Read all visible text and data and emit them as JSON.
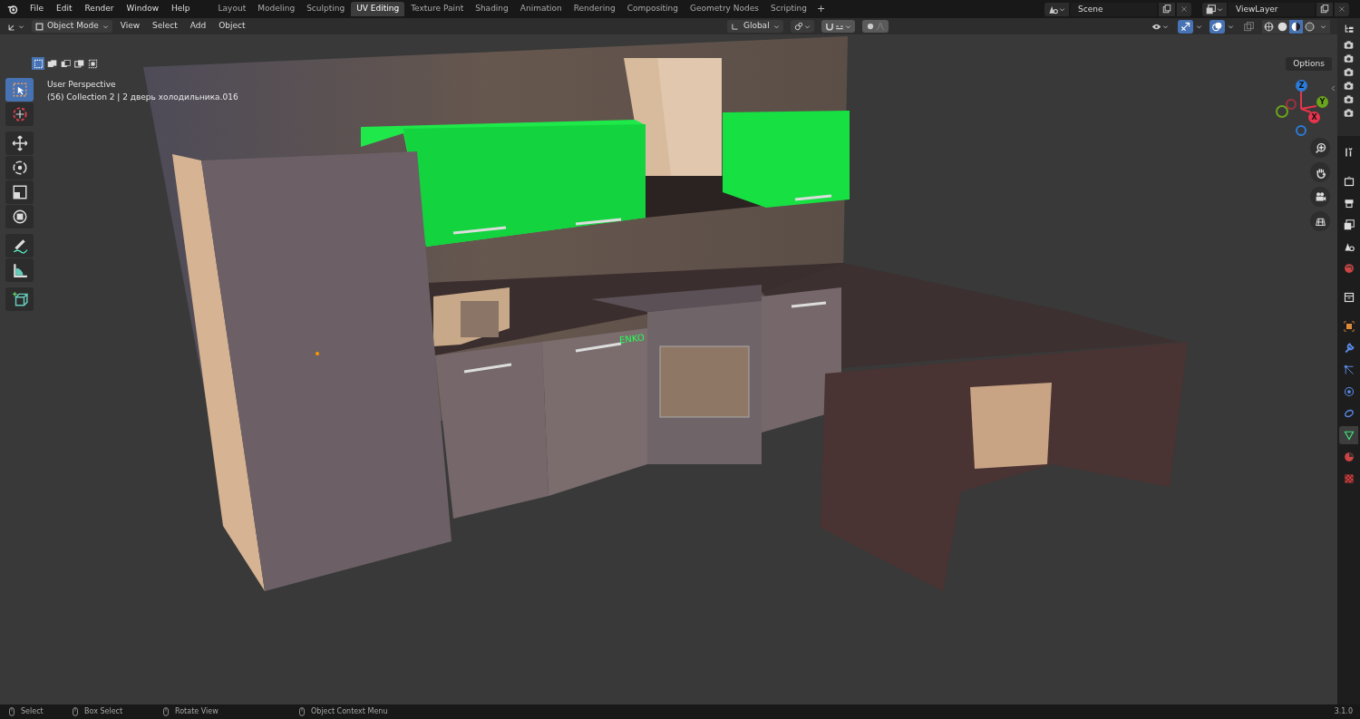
{
  "top_bar": {
    "menus": [
      "File",
      "Edit",
      "Render",
      "Window",
      "Help"
    ],
    "workspaces": [
      {
        "label": "Layout",
        "selected": false
      },
      {
        "label": "Modeling",
        "selected": false
      },
      {
        "label": "Sculpting",
        "selected": false
      },
      {
        "label": "UV Editing",
        "selected": true
      },
      {
        "label": "Texture Paint",
        "selected": false
      },
      {
        "label": "Shading",
        "selected": false
      },
      {
        "label": "Animation",
        "selected": false
      },
      {
        "label": "Rendering",
        "selected": false
      },
      {
        "label": "Compositing",
        "selected": false
      },
      {
        "label": "Geometry Nodes",
        "selected": false
      },
      {
        "label": "Scripting",
        "selected": false
      }
    ],
    "add_workspace": "+",
    "scene": "Scene",
    "view_layer": "ViewLayer"
  },
  "header": {
    "mode": "Object Mode",
    "menus": [
      "View",
      "Select",
      "Add",
      "Object"
    ],
    "orientation": "Global",
    "proportional": {
      "on": true
    },
    "snap": {
      "on": true
    },
    "gizmos": {
      "on": true
    },
    "overlays": {
      "on": true
    },
    "xray": {
      "on": false
    },
    "shading": [
      {
        "kind": "wireframe",
        "selected": false
      },
      {
        "kind": "solid",
        "selected": false
      },
      {
        "kind": "material",
        "selected": true
      },
      {
        "kind": "rendered",
        "selected": false
      }
    ],
    "options": "Options"
  },
  "select_modes": [
    {
      "kind": "new",
      "selected": true
    },
    {
      "kind": "extend",
      "selected": false
    },
    {
      "kind": "subtract",
      "selected": false
    },
    {
      "kind": "invert",
      "selected": false
    },
    {
      "kind": "intersect",
      "selected": false
    }
  ],
  "tools": [
    {
      "kind": "select",
      "selected": true
    },
    {
      "kind": "cursor",
      "selected": false
    },
    {
      "kind": "move",
      "selected": false
    },
    {
      "kind": "rotate",
      "selected": false
    },
    {
      "kind": "scale",
      "selected": false
    },
    {
      "kind": "transform",
      "selected": false
    },
    {
      "kind": "annotate",
      "selected": false
    },
    {
      "kind": "measure",
      "selected": false
    },
    {
      "kind": "add-cube",
      "selected": false
    }
  ],
  "viewport": {
    "info": [
      "User Perspective",
      "(56) Collection 2 | 2 дверь холодильника.016"
    ],
    "axes": [
      "Z",
      "Y",
      "X"
    ],
    "scene_text": "ENKO"
  },
  "properties_tabs": [
    {
      "kind": "tool",
      "selected": false
    },
    {
      "kind": "render",
      "selected": false
    },
    {
      "kind": "output",
      "selected": false
    },
    {
      "kind": "view-layer",
      "selected": false
    },
    {
      "kind": "scene",
      "selected": false
    },
    {
      "kind": "world",
      "selected": false
    },
    {
      "kind": "collection",
      "selected": false
    },
    {
      "kind": "object",
      "selected": false
    },
    {
      "kind": "modifiers",
      "selected": false
    },
    {
      "kind": "particles",
      "selected": false
    },
    {
      "kind": "physics",
      "selected": false
    },
    {
      "kind": "constraints",
      "selected": false
    },
    {
      "kind": "data",
      "selected": true
    },
    {
      "kind": "material",
      "selected": false
    },
    {
      "kind": "texture",
      "selected": false
    }
  ],
  "status_bar": {
    "items": [
      "Select",
      "Box Select",
      "Rotate View",
      "Object Context Menu"
    ],
    "version": "3.1.0"
  }
}
